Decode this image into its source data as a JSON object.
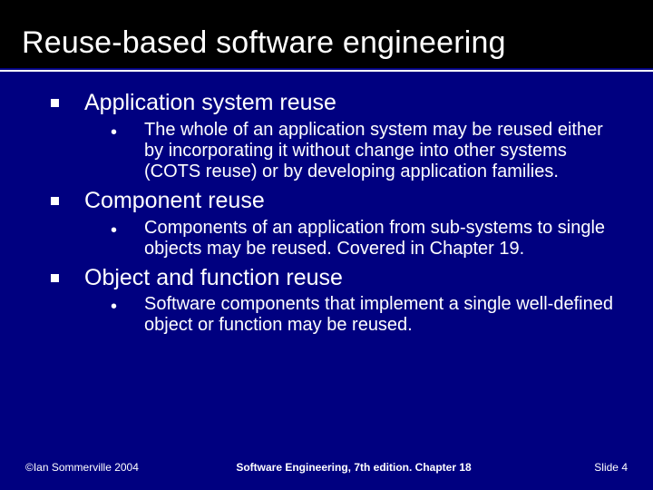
{
  "title": "Reuse-based software engineering",
  "items": [
    {
      "heading": "Application system reuse",
      "sub": "The whole of an application system may be reused either by incorporating it without change into other systems (COTS reuse) or by developing application families."
    },
    {
      "heading": "Component reuse",
      "sub": "Components of an application from sub-systems to single objects may be reused. Covered in Chapter 19."
    },
    {
      "heading": "Object and function reuse",
      "sub": "Software components that implement a single well-defined object or function may be reused."
    }
  ],
  "footer": {
    "left": "©Ian Sommerville 2004",
    "center": "Software Engineering, 7th edition. Chapter 18",
    "right": "Slide 4"
  }
}
